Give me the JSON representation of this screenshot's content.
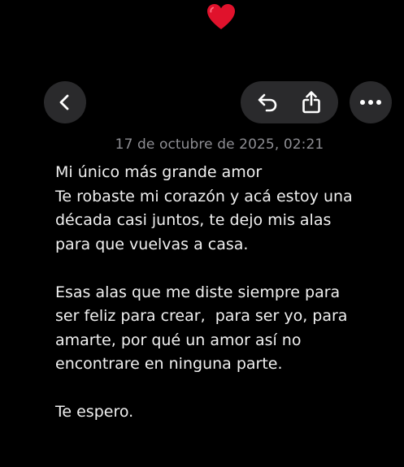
{
  "header": {
    "heart_icon": "heart-icon",
    "back_icon": "chevron-left-icon",
    "reply_icon": "reply-arrow-icon",
    "share_icon": "share-icon",
    "more_icon": "ellipsis-icon"
  },
  "note": {
    "timestamp": "17 de octubre de 2025, 02:21",
    "lines": [
      "Mi único más grande amor",
      "Te robaste mi corazón y acá estoy una",
      "década casi juntos, te dejo mis alas",
      "para que vuelvas a casa.",
      "",
      "Esas alas que me diste siempre para",
      "ser feliz para crear,  para ser yo, para",
      "amarte, por qué un amor así no",
      "encontrare en ninguna parte.",
      "",
      "Te espero."
    ]
  },
  "colors": {
    "background": "#000000",
    "button_bg": "#2a2a2c",
    "text": "#f0f0f0",
    "timestamp": "#8e8e93",
    "heart": "#e0122c"
  }
}
